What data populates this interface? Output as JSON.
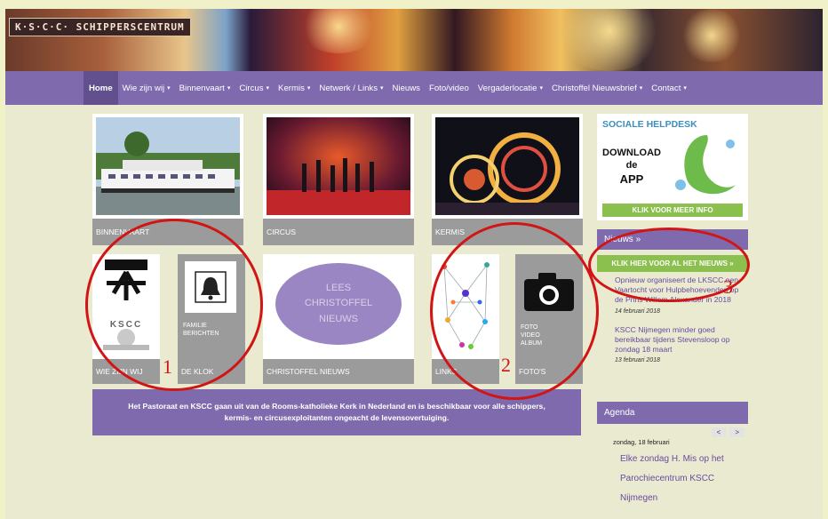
{
  "banner": {
    "logo_text": "K·S·C·C· SCHIPPERSCENTRUM"
  },
  "nav": {
    "items": [
      {
        "label": "Home",
        "dropdown": false,
        "active": true
      },
      {
        "label": "Wie zijn wij",
        "dropdown": true
      },
      {
        "label": "Binnenvaart",
        "dropdown": true
      },
      {
        "label": "Circus",
        "dropdown": true
      },
      {
        "label": "Kermis",
        "dropdown": true
      },
      {
        "label": "Netwerk / Links",
        "dropdown": true
      },
      {
        "label": "Nieuws",
        "dropdown": false
      },
      {
        "label": "Foto/video",
        "dropdown": false
      },
      {
        "label": "Vergaderlocatie",
        "dropdown": true
      },
      {
        "label": "Christoffel Nieuwsbrief",
        "dropdown": true
      },
      {
        "label": "Contact",
        "dropdown": true
      }
    ],
    "chevron": "▾"
  },
  "tiles": {
    "binnenvaart": "BINNENVAART",
    "circus": "CIRCUS",
    "kermis": "KERMIS",
    "wiezijnwij": "WIE ZIJN WIJ",
    "kscc": "KSCC",
    "deklok": "DE KLOK",
    "familie": [
      "FAMILIE",
      "BERICHTEN"
    ],
    "christoffel": "CHRISTOFFEL NIEUWS",
    "lees": [
      "LEES",
      "CHRISTOFFEL",
      "NIEUWS"
    ],
    "links": "LINKS",
    "fotos": "FOTO'S",
    "album": [
      "FOTO",
      "VIDEO",
      "ALBUM"
    ]
  },
  "intro_text": "Het Pastoraat en KSCC gaan uit van de Rooms-katholieke Kerk in Nederland en is beschikbaar voor alle schippers, kermis- en circusexploitanten ongeacht de levensovertuiging.",
  "annotations": [
    "1",
    "2",
    "3"
  ],
  "helpdesk": {
    "title": "SOCIALE HELPDESK",
    "line1": "DOWNLOAD",
    "line2": "de",
    "line3": "APP",
    "button": "KLIK VOOR MEER INFO"
  },
  "news": {
    "header": "Nieuws »",
    "all_button": "KLIK HIER VOOR AL HET NIEUWS »",
    "items": [
      {
        "title": "Opnieuw organiseert de LKSCC een Vaartocht voor Hulpbehoevenden op de Prins Willem Alexander in 2018",
        "date": "14 februari 2018"
      },
      {
        "title": "KSCC Nijmegen minder goed bereikbaar tijdens Stevensloop op zondag 18 maart",
        "date": "13 februari 2018"
      }
    ]
  },
  "agenda": {
    "header": "Agenda",
    "prev": "<",
    "next": ">",
    "date": "zondag, 18 februari",
    "event_lines": [
      "Elke zondag H. Mis op het",
      "Parochiecentrum KSCC",
      "Nijmegen"
    ]
  },
  "colors": {
    "purple": "#7f6aae",
    "grey": "#9b9b9b",
    "green": "#8bbf4e",
    "red": "#d11515"
  }
}
